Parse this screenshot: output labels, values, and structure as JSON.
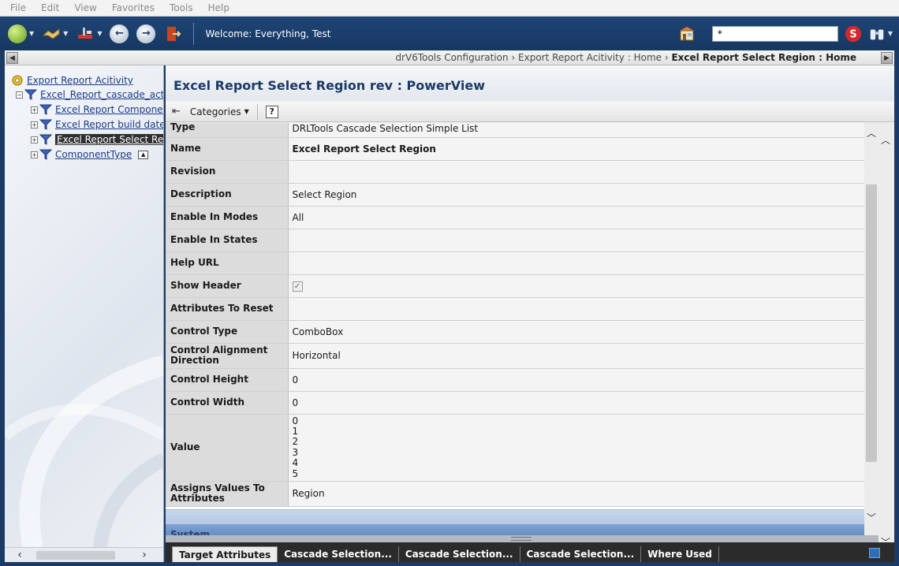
{
  "menu": [
    "File",
    "Edit",
    "View",
    "Favorites",
    "Tools",
    "Help"
  ],
  "toolbar": {
    "welcome": "Welcome: Everything, Test",
    "search_value": "*"
  },
  "breadcrumb": {
    "parts": "drV6Tools Configuration › Export Report Acitivity : Home › ",
    "current": "Excel Report Select Region : Home"
  },
  "tree": {
    "root": "Export Report Acitivity",
    "child": "Excel_Report_cascade_act",
    "items": [
      "Excel Report Componer",
      "Excel Report build date",
      "Excel Report Select Rec",
      "ComponentType"
    ]
  },
  "main": {
    "title": "Excel Report Select Region rev : PowerView",
    "categories_label": "Categories",
    "help_label": "?"
  },
  "properties": [
    {
      "label": "Type",
      "value": "DRLTools Cascade Selection Simple List"
    },
    {
      "label": "Name",
      "value": "Excel Report Select Region"
    },
    {
      "label": "Revision",
      "value": ""
    },
    {
      "label": "Description",
      "value": "Select Region"
    },
    {
      "label": "Enable In Modes",
      "value": "All"
    },
    {
      "label": "Enable In States",
      "value": ""
    },
    {
      "label": "Help URL",
      "value": ""
    },
    {
      "label": "Show Header",
      "value": "✓"
    },
    {
      "label": "Attributes To Reset",
      "value": ""
    },
    {
      "label": "Control Type",
      "value": "ComboBox"
    },
    {
      "label": "Control Alignment Direction",
      "value": "Horizontal"
    },
    {
      "label": "Control Height",
      "value": "0"
    },
    {
      "label": "Control Width",
      "value": "0"
    },
    {
      "label": "Value",
      "values": [
        "0",
        "1",
        "2",
        "3",
        "4",
        "5"
      ]
    },
    {
      "label": "Assigns Values To Attributes",
      "value": "Region"
    }
  ],
  "system_section": "System",
  "tabs": [
    "Target Attributes",
    "Cascade Selection...",
    "Cascade Selection...",
    "Cascade Selection...",
    "Where Used"
  ]
}
